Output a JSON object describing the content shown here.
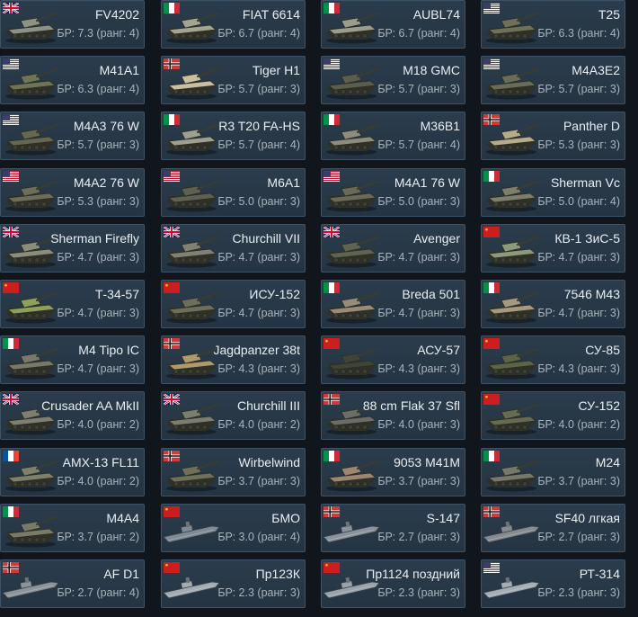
{
  "vehicles": [
    {
      "name": "FV4202",
      "br": "БР: 7.3 (ранг: 4)",
      "nation": "uk",
      "kind": "tank",
      "hull_color": "#8c9285"
    },
    {
      "name": "FIAT 6614",
      "br": "БР: 6.7 (ранг: 4)",
      "nation": "italy",
      "kind": "tank",
      "hull_color": "#a3a58e"
    },
    {
      "name": "AUBL74",
      "br": "БР: 6.7 (ранг: 4)",
      "nation": "italy",
      "kind": "tank",
      "hull_color": "#9b9d8c"
    },
    {
      "name": "T25",
      "br": "БР: 6.3 (ранг: 4)",
      "nation": "usa",
      "kind": "tank",
      "hull_color": "#6e7058"
    },
    {
      "name": "M41A1",
      "br": "БР: 6.3 (ранг: 4)",
      "nation": "usa",
      "kind": "tank",
      "hull_color": "#6f7455"
    },
    {
      "name": "Tiger H1",
      "br": "БР: 5.7 (ранг: 3)",
      "nation": "germany",
      "kind": "tank",
      "hull_color": "#c9bf9e"
    },
    {
      "name": "M18 GMC",
      "br": "БР: 5.7 (ранг: 3)",
      "nation": "usa",
      "kind": "tank",
      "hull_color": "#5c5e4c"
    },
    {
      "name": "M4A3E2",
      "br": "БР: 5.7 (ранг: 3)",
      "nation": "usa",
      "kind": "tank",
      "hull_color": "#6a6c57"
    },
    {
      "name": "M4A3 76 W",
      "br": "БР: 5.7 (ранг: 3)",
      "nation": "usa",
      "kind": "tank",
      "hull_color": "#656752"
    },
    {
      "name": "R3 T20 FA-HS",
      "br": "БР: 5.7 (ранг: 4)",
      "nation": "italy",
      "kind": "tank",
      "hull_color": "#9ea08f"
    },
    {
      "name": "M36B1",
      "br": "БР: 5.7 (ранг: 4)",
      "nation": "italy",
      "kind": "tank",
      "hull_color": "#8d8d7c"
    },
    {
      "name": "Panther D",
      "br": "БР: 5.3 (ранг: 3)",
      "nation": "germany",
      "kind": "tank",
      "hull_color": "#b7ac8a"
    },
    {
      "name": "M4A2 76 W",
      "br": "БР: 5.3 (ранг: 3)",
      "nation": "usa",
      "kind": "tank",
      "hull_color": "#6c6e58"
    },
    {
      "name": "M6A1",
      "br": "БР: 5.0 (ранг: 3)",
      "nation": "usa",
      "kind": "tank",
      "hull_color": "#5f6150"
    },
    {
      "name": "M4A1 76 W",
      "br": "БР: 5.0 (ранг: 3)",
      "nation": "usa",
      "kind": "tank",
      "hull_color": "#6a6a56"
    },
    {
      "name": "Sherman Vc",
      "br": "БР: 5.0 (ранг: 4)",
      "nation": "italy",
      "kind": "tank",
      "hull_color": "#7d7f6c"
    },
    {
      "name": "Sherman Firefly",
      "br": "БР: 4.7 (ранг: 3)",
      "nation": "uk",
      "kind": "tank",
      "hull_color": "#8a8d7c"
    },
    {
      "name": "Churchill VII",
      "br": "БР: 4.7 (ранг: 3)",
      "nation": "uk",
      "kind": "tank",
      "hull_color": "#7f8272"
    },
    {
      "name": "Avenger",
      "br": "БР: 4.7 (ранг: 3)",
      "nation": "uk",
      "kind": "tank",
      "hull_color": "#5e6450"
    },
    {
      "name": "КВ-1 ЗиС-5",
      "br": "БР: 4.7 (ранг: 3)",
      "nation": "ussr",
      "kind": "tank",
      "hull_color": "#8b9a79"
    },
    {
      "name": "Т-34-57",
      "br": "БР: 4.7 (ранг: 3)",
      "nation": "ussr",
      "kind": "tank",
      "hull_color": "#8ea15c"
    },
    {
      "name": "ИСУ-152",
      "br": "БР: 4.7 (ранг: 3)",
      "nation": "ussr",
      "kind": "tank",
      "hull_color": "#6d6f5c"
    },
    {
      "name": "Breda 501",
      "br": "БР: 4.7 (ранг: 3)",
      "nation": "italy",
      "kind": "tank",
      "hull_color": "#9a8a78"
    },
    {
      "name": "7546 M43",
      "br": "БР: 4.7 (ранг: 3)",
      "nation": "italy",
      "kind": "tank",
      "hull_color": "#a59a7e"
    },
    {
      "name": "M4 Tipo IC",
      "br": "БР: 4.7 (ранг: 3)",
      "nation": "italy",
      "kind": "tank",
      "hull_color": "#77796a"
    },
    {
      "name": "Jagdpanzer 38t",
      "br": "БР: 4.3 (ранг: 3)",
      "nation": "germany",
      "kind": "tank",
      "hull_color": "#b09a6a"
    },
    {
      "name": "АСУ-57",
      "br": "БР: 4.3 (ранг: 3)",
      "nation": "ussr",
      "kind": "tank",
      "hull_color": "#3f4436"
    },
    {
      "name": "СУ-85",
      "br": "БР: 4.3 (ранг: 3)",
      "nation": "ussr",
      "kind": "tank",
      "hull_color": "#5b6447"
    },
    {
      "name": "Crusader AA MkII",
      "br": "БР: 4.0 (ранг: 2)",
      "nation": "uk",
      "kind": "tank",
      "hull_color": "#7d7f70"
    },
    {
      "name": "Churchill III",
      "br": "БР: 4.0 (ранг: 2)",
      "nation": "uk",
      "kind": "tank",
      "hull_color": "#7b7e6f"
    },
    {
      "name": "88 cm Flak 37 Sfl",
      "br": "БР: 4.0 (ранг: 3)",
      "nation": "germany",
      "kind": "tank",
      "hull_color": "#6c6d66"
    },
    {
      "name": "СУ-152",
      "br": "БР: 4.0 (ранг: 2)",
      "nation": "ussr",
      "kind": "tank",
      "hull_color": "#656a50"
    },
    {
      "name": "AMX-13 FL11",
      "br": "БР: 4.0 (ранг: 2)",
      "nation": "france",
      "kind": "tank",
      "hull_color": "#7e806c"
    },
    {
      "name": "Wirbelwind",
      "br": "БР: 3.7 (ранг: 3)",
      "nation": "germany",
      "kind": "tank",
      "hull_color": "#6e7059"
    },
    {
      "name": "9053 M41M",
      "br": "БР: 3.7 (ранг: 3)",
      "nation": "italy",
      "kind": "tank",
      "hull_color": "#9c8670"
    },
    {
      "name": "M24",
      "br": "БР: 3.7 (ранг: 3)",
      "nation": "italy",
      "kind": "tank",
      "hull_color": "#75786a"
    },
    {
      "name": "M4A4",
      "br": "БР: 3.7 (ранг: 2)",
      "nation": "italy",
      "kind": "tank",
      "hull_color": "#787b68"
    },
    {
      "name": "БМО",
      "br": "БР: 3.0 (ранг: 4)",
      "nation": "ussr",
      "kind": "boat",
      "hull_color": "#7f8a95"
    },
    {
      "name": "S-147",
      "br": "БР: 2.7 (ранг: 3)",
      "nation": "germany",
      "kind": "boat",
      "hull_color": "#8a939b"
    },
    {
      "name": "SF40 лгкая",
      "br": "БР: 2.7 (ранг: 3)",
      "nation": "germany",
      "kind": "boat",
      "hull_color": "#858b8f"
    },
    {
      "name": "AF D1",
      "br": "БР: 2.7 (ранг: 4)",
      "nation": "germany",
      "kind": "boat",
      "hull_color": "#8c9399"
    },
    {
      "name": "Пр123К",
      "br": "БР: 2.3 (ранг: 3)",
      "nation": "ussr",
      "kind": "boat",
      "hull_color": "#a3acb3"
    },
    {
      "name": "Пр1124 поздний",
      "br": "БР: 2.3 (ранг: 3)",
      "nation": "ussr",
      "kind": "boat",
      "hull_color": "#9aa3ab"
    },
    {
      "name": "РТ-314",
      "br": "БР: 2.3 (ранг: 3)",
      "nation": "usa",
      "kind": "boat",
      "hull_color": "#a6aeb5"
    }
  ]
}
